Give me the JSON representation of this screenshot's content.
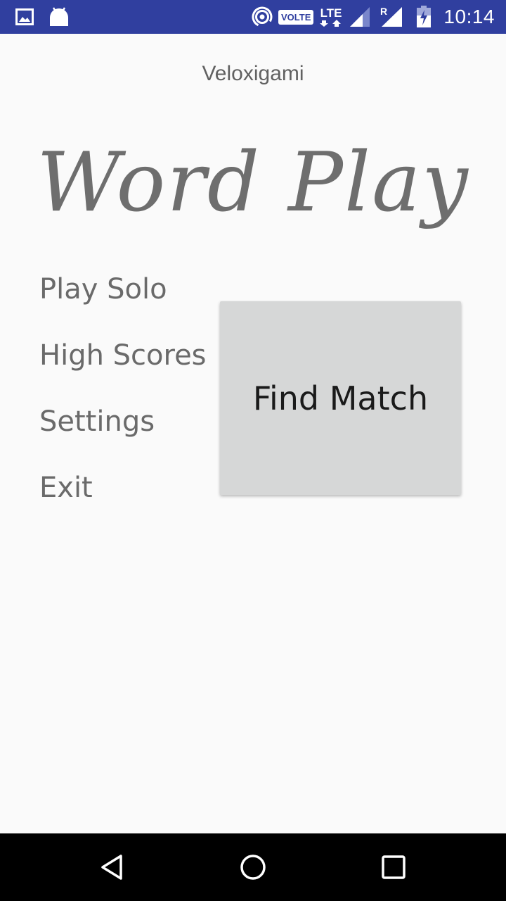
{
  "status_bar": {
    "time": "10:14",
    "volte_label": "VOLTE",
    "lte_label": "LTE",
    "roaming_label": "R",
    "icons": [
      "image-icon",
      "android-icon",
      "hotspot-icon",
      "signal-icon",
      "roaming-signal-icon",
      "battery-charging-icon"
    ],
    "background": "#303f9f"
  },
  "app": {
    "developer": "Veloxigami",
    "logo_text": "Word Play"
  },
  "menu": {
    "items": [
      {
        "label": "Play Solo"
      },
      {
        "label": "High Scores"
      },
      {
        "label": "Settings"
      },
      {
        "label": "Exit"
      }
    ]
  },
  "find_match": {
    "label": "Find Match",
    "background": "#d6d7d7"
  },
  "nav_bar": {
    "icons": [
      "back-icon",
      "home-icon",
      "recents-icon"
    ]
  }
}
